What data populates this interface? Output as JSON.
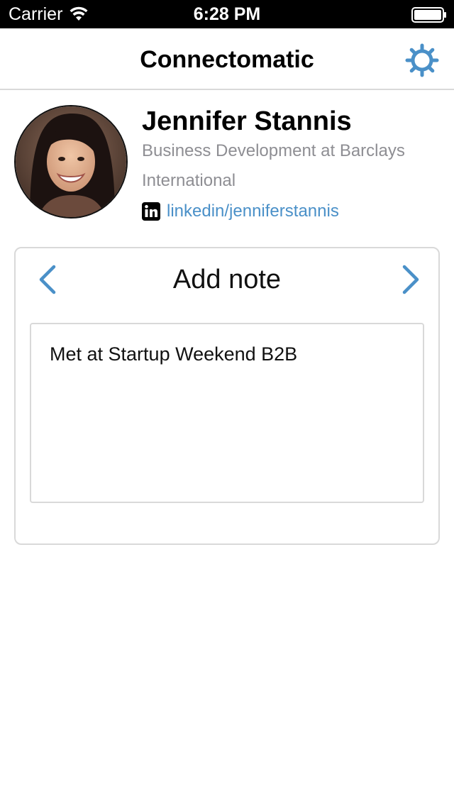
{
  "status_bar": {
    "carrier": "Carrier",
    "time": "6:28 PM",
    "wifi_icon": "wifi-icon",
    "battery_icon": "battery-icon"
  },
  "nav": {
    "title": "Connectomatic",
    "settings_icon": "gear-icon"
  },
  "profile": {
    "name": "Jennifer Stannis",
    "title": "Business Development at Barclays International",
    "linkedin_icon": "linkedin-icon",
    "linkedin_handle": "linkedin/jenniferstannis"
  },
  "note": {
    "heading": "Add note",
    "prev_icon": "chevron-left-icon",
    "next_icon": "chevron-right-icon",
    "text": "Met at Startup Weekend B2B"
  },
  "colors": {
    "accent": "#4a90c8",
    "secondary_text": "#8e8e93",
    "border": "#d9d9d9",
    "status_bar": "#000000"
  }
}
